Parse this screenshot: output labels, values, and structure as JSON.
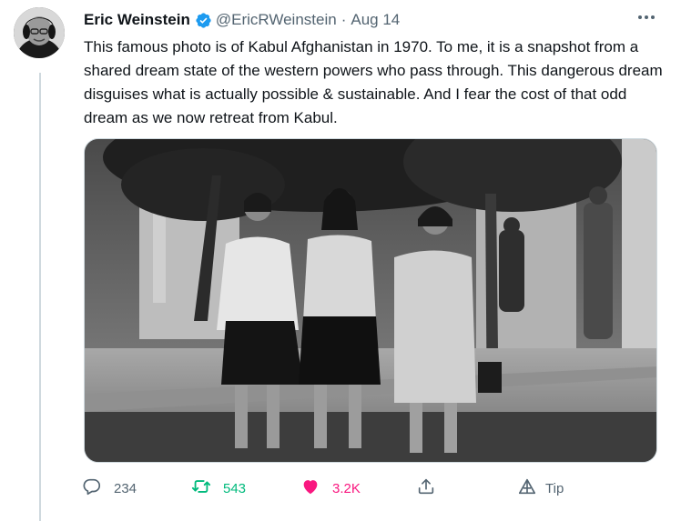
{
  "tweet": {
    "author": {
      "display_name": "Eric Weinstein",
      "handle": "@EricRWeinstein",
      "verified": true
    },
    "separator": "·",
    "date": "Aug 14",
    "text": "This famous photo is of Kabul Afghanistan in 1970. To me, it is a snapshot from a shared dream state of the western powers who pass through. This dangerous dream disguises what is actually possible & sustainable. And I fear the cost of that odd dream as we now retreat from Kabul.",
    "media": {
      "kind": "black-and-white photograph",
      "icon": "photo"
    },
    "actions": {
      "replies": "234",
      "retweets": "543",
      "likes": "3.2K",
      "tip_label": "Tip"
    }
  },
  "icons": {
    "more": "more-dots-icon",
    "reply": "reply-bubble-icon",
    "retweet": "retweet-arrows-icon",
    "like": "heart-filled-icon",
    "share": "share-upload-icon",
    "tip": "tip-triangle-icon",
    "verified": "verified-badge-icon"
  },
  "colors": {
    "primary_text": "#0f1419",
    "secondary_text": "#536471",
    "verified": "#1d9bf0",
    "retweet": "#00ba7c",
    "like": "#f91880",
    "border": "#cfd9de"
  }
}
